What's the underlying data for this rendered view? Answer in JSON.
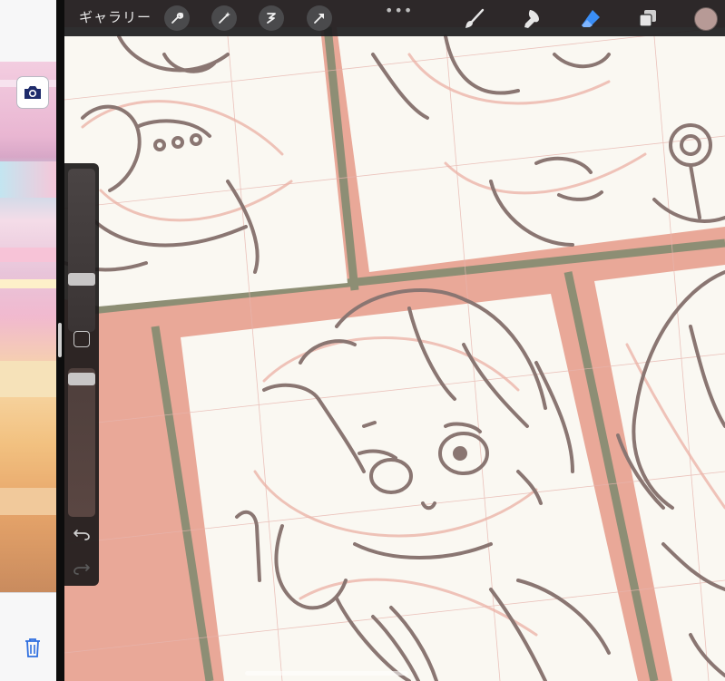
{
  "toolbar": {
    "gallery_label": "ギャラリー",
    "more_label": "•••",
    "tools": [
      "wrench-icon",
      "magic-wand-icon",
      "selection-icon",
      "transform-arrow-icon"
    ],
    "right_tools": [
      "brush-icon",
      "smudge-icon",
      "eraser-icon",
      "layers-icon"
    ],
    "active_tool": "eraser-icon",
    "active_color": "#b79a96",
    "accent": "#3a8ef6"
  },
  "sidebar": {
    "controls": [
      "brush-size-slider",
      "modify-button",
      "opacity-slider",
      "undo-icon",
      "redo-icon"
    ]
  },
  "left_app": {
    "icons": [
      "camera-icon",
      "trash-icon"
    ]
  }
}
